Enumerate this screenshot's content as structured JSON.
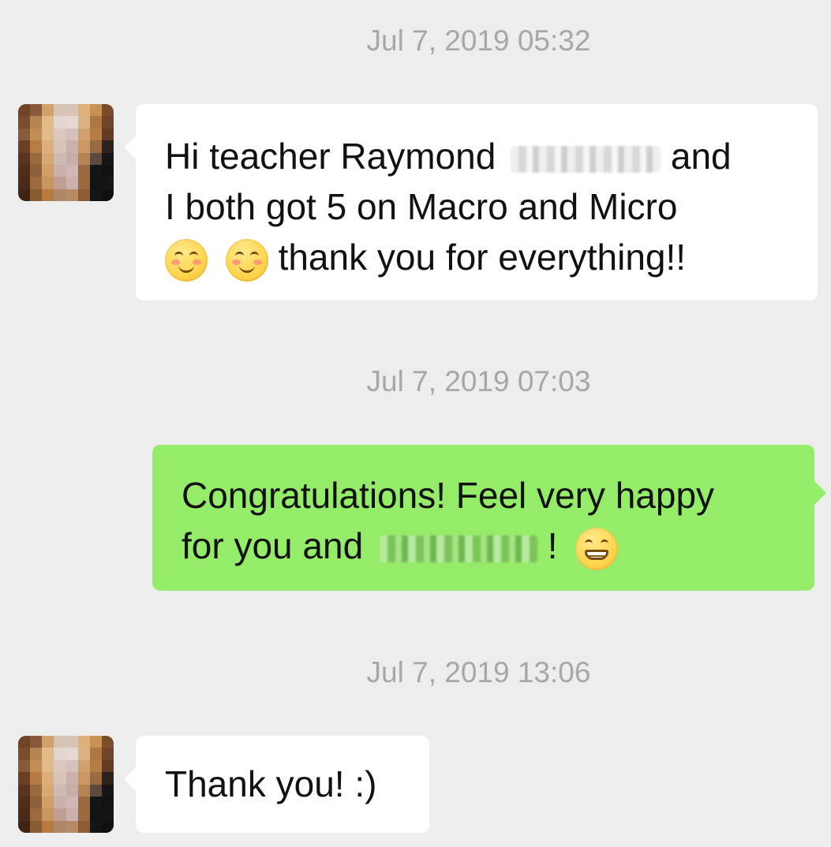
{
  "chat": {
    "timestamps": [
      "Jul 7, 2019 05:32",
      "Jul 7, 2019 07:03",
      "Jul 7, 2019 13:06"
    ],
    "messages": [
      {
        "sender": "received",
        "line1_before": "Hi teacher Raymond",
        "line1_after": " and",
        "line2": "I both got 5 on Macro and Micro",
        "line3": " thank you for everything!!",
        "emoji": [
          "smiling-blush-emoji",
          "smiling-blush-emoji"
        ]
      },
      {
        "sender": "sent",
        "line1": "Congratulations! Feel very happy",
        "line2_before": "for you and",
        "line2_after": "!",
        "emoji": [
          "grinning-emoji"
        ]
      },
      {
        "sender": "received",
        "text": "Thank you! :)"
      }
    ]
  },
  "colors": {
    "background": "#ededed",
    "received_bubble": "#ffffff",
    "sent_bubble": "#95ec69",
    "timestamp_text": "#a7a7a7",
    "message_text": "#111111"
  },
  "icons": {
    "avatar": "contact-avatar",
    "smile": "smiling-blush-emoji",
    "grin": "grinning-emoji"
  }
}
